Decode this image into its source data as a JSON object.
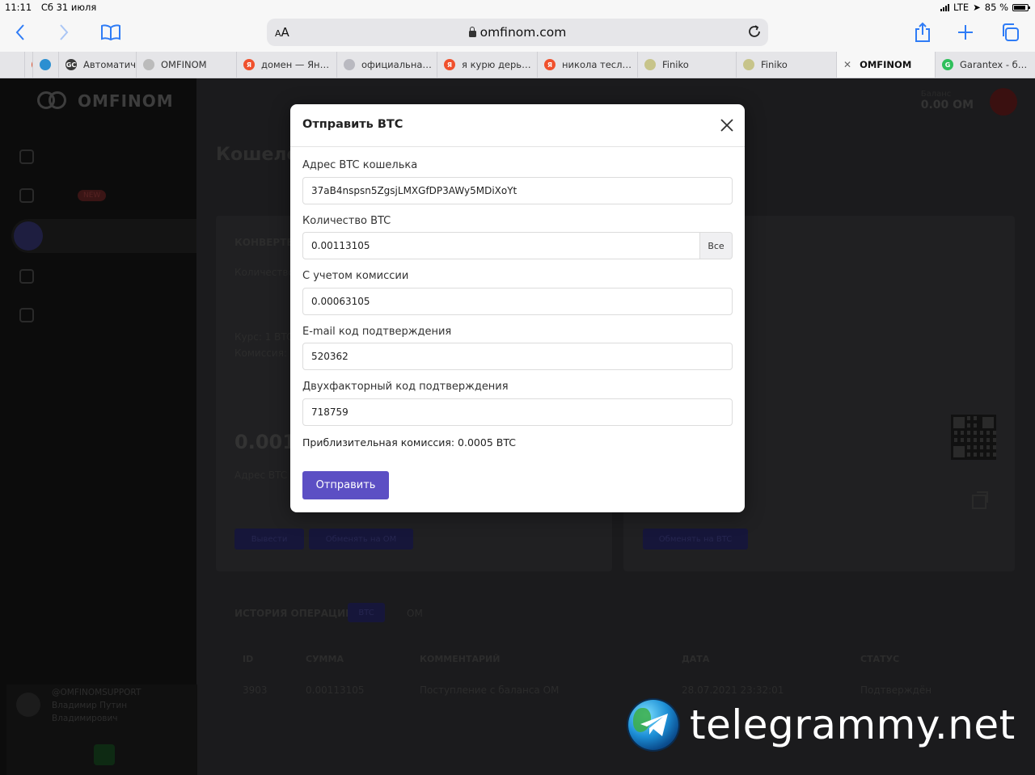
{
  "status_bar": {
    "time": "11:11",
    "date": "Сб 31 июля",
    "network": "LTE",
    "battery": "85 %",
    "battery_level": 0.85
  },
  "browser": {
    "text_size_label": "AA",
    "url": "omfinom.com",
    "icons": {
      "back": "chevron-left-icon",
      "forward": "chevron-right-icon",
      "bookmarks": "book-icon",
      "share": "share-icon",
      "new_tab": "plus-icon",
      "tabs": "tabs-icon",
      "reload": "reload-icon"
    },
    "tabs": [
      {
        "label": "",
        "fav_color": "#e5502b",
        "fav_text": ""
      },
      {
        "label": "",
        "fav_color": "#2b8fd1",
        "fav_text": ""
      },
      {
        "label": "Автоматич",
        "fav_color": "#3a3a3a",
        "fav_text": "GC"
      },
      {
        "label": "OMFINOM",
        "fav_color": "#bbbbbb",
        "fav_text": ""
      },
      {
        "label": "домен — Ян…",
        "fav_color": "#f0512d",
        "fav_text": "Я"
      },
      {
        "label": "официальна…",
        "fav_color": "#b9b9c0",
        "fav_text": ""
      },
      {
        "label": "я курю дерь…",
        "fav_color": "#f0512d",
        "fav_text": "Я"
      },
      {
        "label": "никола тесл…",
        "fav_color": "#f0512d",
        "fav_text": "Я"
      },
      {
        "label": "Finiko",
        "fav_color": "#c7c48a",
        "fav_text": ""
      },
      {
        "label": "Finiko",
        "fav_color": "#c7c48a",
        "fav_text": ""
      },
      {
        "label": "OMFINOM",
        "fav_color": "",
        "fav_text": "",
        "active": true
      },
      {
        "label": "Garantex - б…",
        "fav_color": "#2fbf5b",
        "fav_text": "G"
      }
    ]
  },
  "background": {
    "logo": "OMFINOM",
    "page_title": "Кошелёк",
    "balance_label": "Баланс",
    "balance_value": "0.00 OM",
    "nav_badge": "NEW",
    "support_line1": "@OMFINOMSUPPORT",
    "support_line2": "Владимир Путин",
    "support_line3": "Владимирович",
    "section_history": "ИСТОРИЯ ОПЕРАЦИЙ",
    "history_tab_btc": "BTC",
    "history_tab_om": "OM",
    "history_columns": [
      "ID",
      "СУММА",
      "КОММЕНТАРИЙ",
      "ДАТА",
      "СТАТУС"
    ],
    "history_rows": [
      [
        "3903",
        "0.00113105",
        "Поступление с баланса OM",
        "28.07.2021 23:32:01",
        "Подтверждён"
      ]
    ],
    "converter_label": "КОНВЕРТЕР",
    "amount_label": "Количество",
    "rate_label": "Курс: 1 BTC",
    "fee_label": "Комиссия:",
    "balance_preview": "0.0011",
    "btc_address_label": "Адрес BTC",
    "btn_withdraw": "Вывести",
    "btn_exchange_om": "Обменять на OM",
    "btn_exchange_btc": "Обменять на BTC"
  },
  "modal": {
    "title": "Отправить BTC",
    "address_label": "Адрес BTC кошелька",
    "address_value": "37aB4nspsn5ZgsjLMXGfDP3AWy5MDiXoYt",
    "amount_label": "Количество BTC",
    "amount_value": "0.00113105",
    "all_button": "Все",
    "with_fee_label": "С учетом комиссии",
    "with_fee_value": "0.00063105",
    "email_code_label": "E-mail код подтверждения",
    "email_code_value": "520362",
    "twofa_label": "Двухфакторный код подтверждения",
    "twofa_value": "718759",
    "fee_note": "Приблизительная комиссия: 0.0005 BTC",
    "submit_label": "Отправить"
  },
  "watermark": {
    "text": "telegrammy.net"
  },
  "colors": {
    "accent": "#5c4fc4",
    "ios_blue": "#2f7cf6"
  }
}
